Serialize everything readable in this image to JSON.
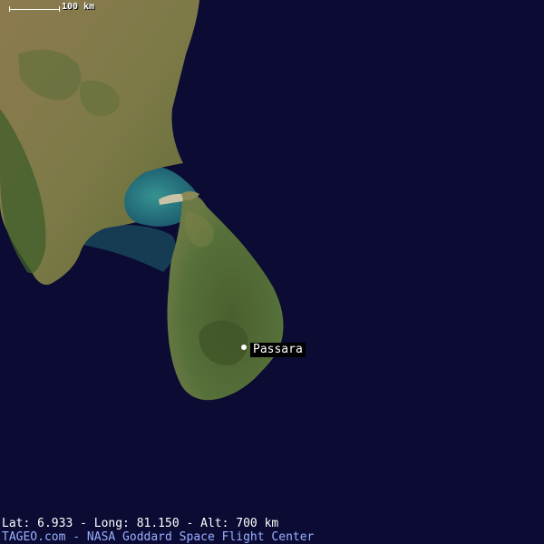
{
  "scale": {
    "label": "100 km"
  },
  "marker": {
    "name": "Passara"
  },
  "footer": {
    "coords": "Lat: 6.933 - Long: 81.150 - Alt: 700 km",
    "credit": "TAGEO.com -  NASA Goddard Space Flight Center"
  },
  "colors": {
    "ocean": "#0b0b33",
    "shallow_water": "#2f8f8a",
    "land_dry": "#9a8a5c",
    "land_green": "#4f6b2c",
    "footer_text": "#ffffff",
    "footer_credit": "#9ab0ff"
  }
}
